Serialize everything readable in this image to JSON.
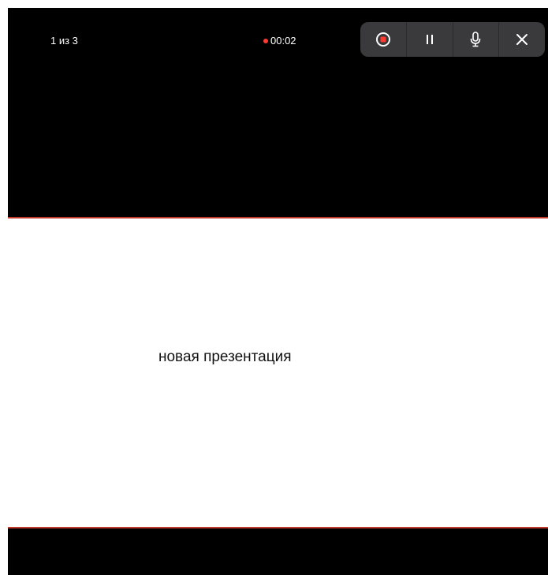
{
  "top_bar": {
    "slide_counter": "1 из 3",
    "timer": "00:02",
    "recording_indicator_color": "#ff3b30"
  },
  "controls": [
    {
      "icon": "record-icon"
    },
    {
      "icon": "pause-icon"
    },
    {
      "icon": "microphone-icon"
    },
    {
      "icon": "close-icon"
    }
  ],
  "slide": {
    "title": "новая презентация"
  },
  "colors": {
    "background": "#000000",
    "slide_background": "#ffffff",
    "slide_border": "#c0392b",
    "controls_background": "#3a3a3c",
    "record_red": "#ff3b30"
  }
}
